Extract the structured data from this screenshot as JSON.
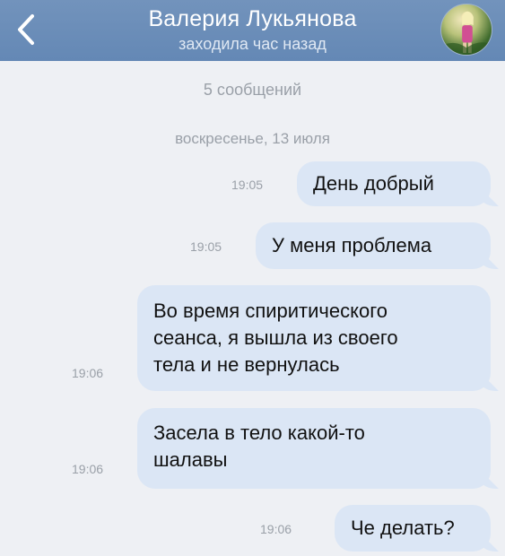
{
  "header": {
    "back_icon": "chevron-left-icon",
    "contact_name": "Валерия Лукьянова",
    "status": "заходила час назад",
    "avatar_icon": "contact-avatar",
    "colors": {
      "bar": "#6d8fb9",
      "text": "#ffffff"
    }
  },
  "conversation": {
    "message_count": "5 сообщений",
    "date": "воскресенье, 13 июля",
    "bubble_color": "#dbe6f5",
    "messages": [
      {
        "time": "19:05",
        "lines": [
          "День добрый"
        ]
      },
      {
        "time": "19:05",
        "lines": [
          "У меня проблема"
        ]
      },
      {
        "time": "19:06",
        "lines": [
          "Во время спиритического",
          "сеанса, я вышла из своего",
          "тела и не вернулась"
        ]
      },
      {
        "time": "19:06",
        "lines": [
          "Засела в тело какой-то",
          "шалавы"
        ]
      },
      {
        "time": "19:06",
        "lines": [
          "Че делать?"
        ]
      }
    ]
  }
}
